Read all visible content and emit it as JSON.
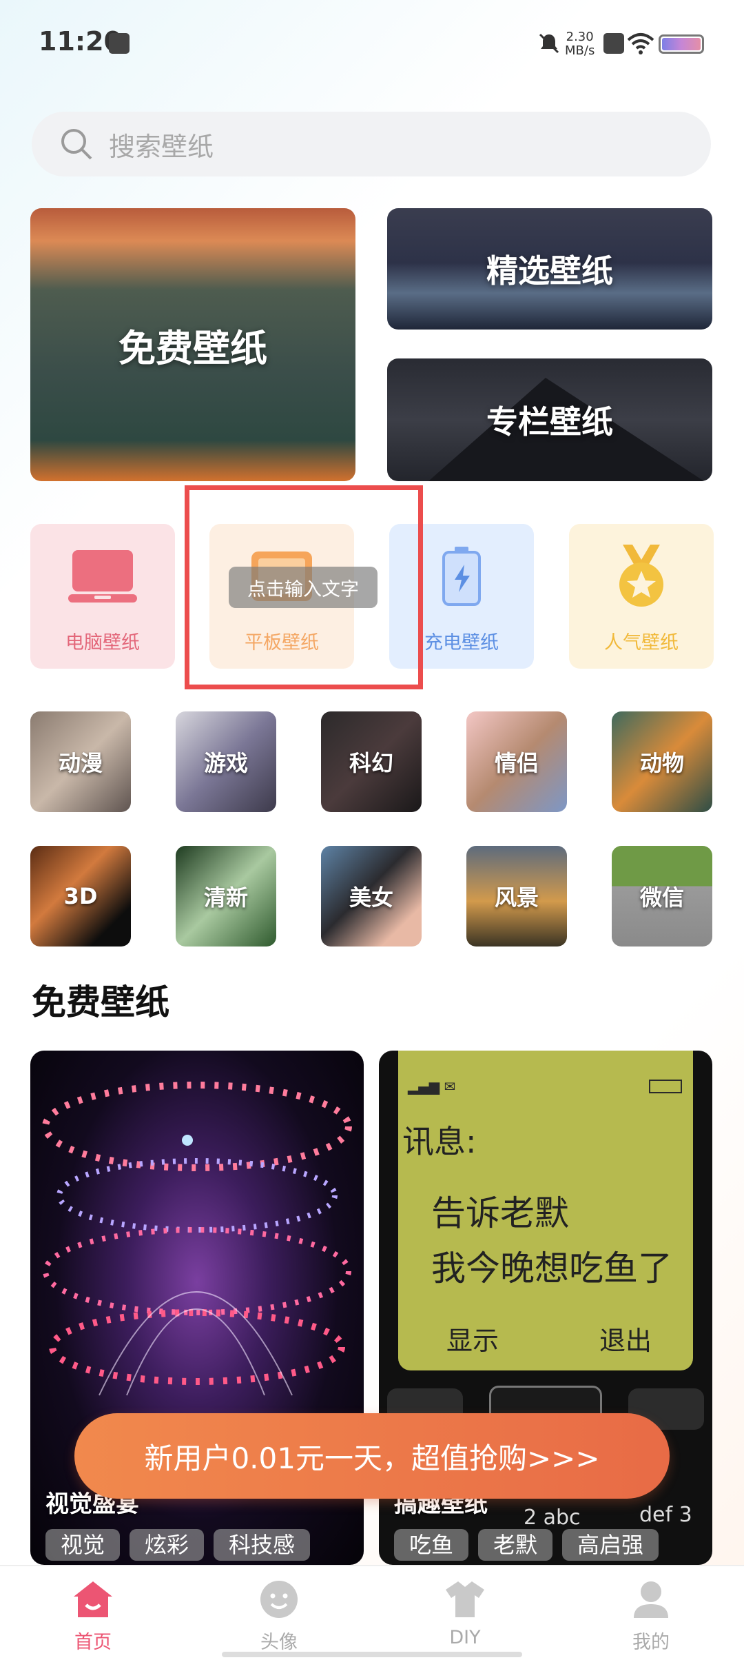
{
  "status_bar": {
    "time": "11:20",
    "net_speed_value": "2.30",
    "net_speed_unit": "MB/s"
  },
  "search": {
    "placeholder": "搜索壁纸"
  },
  "banners": {
    "free": "免费壁纸",
    "featured": "精选壁纸",
    "column": "专栏壁纸"
  },
  "categories": [
    {
      "label": "电脑壁纸",
      "icon": "laptop-icon",
      "color": "#e36679"
    },
    {
      "label": "平板壁纸",
      "icon": "tablet-icon",
      "color": "#f4a764"
    },
    {
      "label": "充电壁纸",
      "icon": "battery-charging-icon",
      "color": "#5c8fe3"
    },
    {
      "label": "人气壁纸",
      "icon": "medal-star-icon",
      "color": "#f1b93a"
    }
  ],
  "tooltip": "点击输入文字",
  "tiles": [
    {
      "label": "动漫"
    },
    {
      "label": "游戏"
    },
    {
      "label": "科幻"
    },
    {
      "label": "情侣"
    },
    {
      "label": "动物"
    },
    {
      "label": "3D"
    },
    {
      "label": "清新"
    },
    {
      "label": "美女"
    },
    {
      "label": "风景"
    },
    {
      "label": "微信"
    }
  ],
  "section": {
    "title": "免费壁纸"
  },
  "wallpapers": [
    {
      "title": "视觉盛宴",
      "tags": [
        "视觉",
        "炫彩",
        "科技感"
      ]
    },
    {
      "title": "搞趣壁纸",
      "tags": [
        "吃鱼",
        "老默",
        "高启强"
      ],
      "phone": {
        "heading": "讯息:",
        "line1": "告诉老默",
        "line2": "我今晚想吃鱼了",
        "left_soft": "显示",
        "right_soft": "退出",
        "key2": "2 abc",
        "key3": "def 3"
      }
    }
  ],
  "promo": {
    "text": "新用户0.01元一天，超值抢购>>>"
  },
  "tabs": [
    {
      "label": "首页",
      "icon": "home-icon"
    },
    {
      "label": "头像",
      "icon": "smiley-icon"
    },
    {
      "label": "DIY",
      "icon": "tshirt-icon"
    },
    {
      "label": "我的",
      "icon": "user-icon"
    }
  ],
  "colors": {
    "accent": "#ec5573",
    "highlight_box": "#ec4d4d",
    "promo": "#ec7a49"
  }
}
